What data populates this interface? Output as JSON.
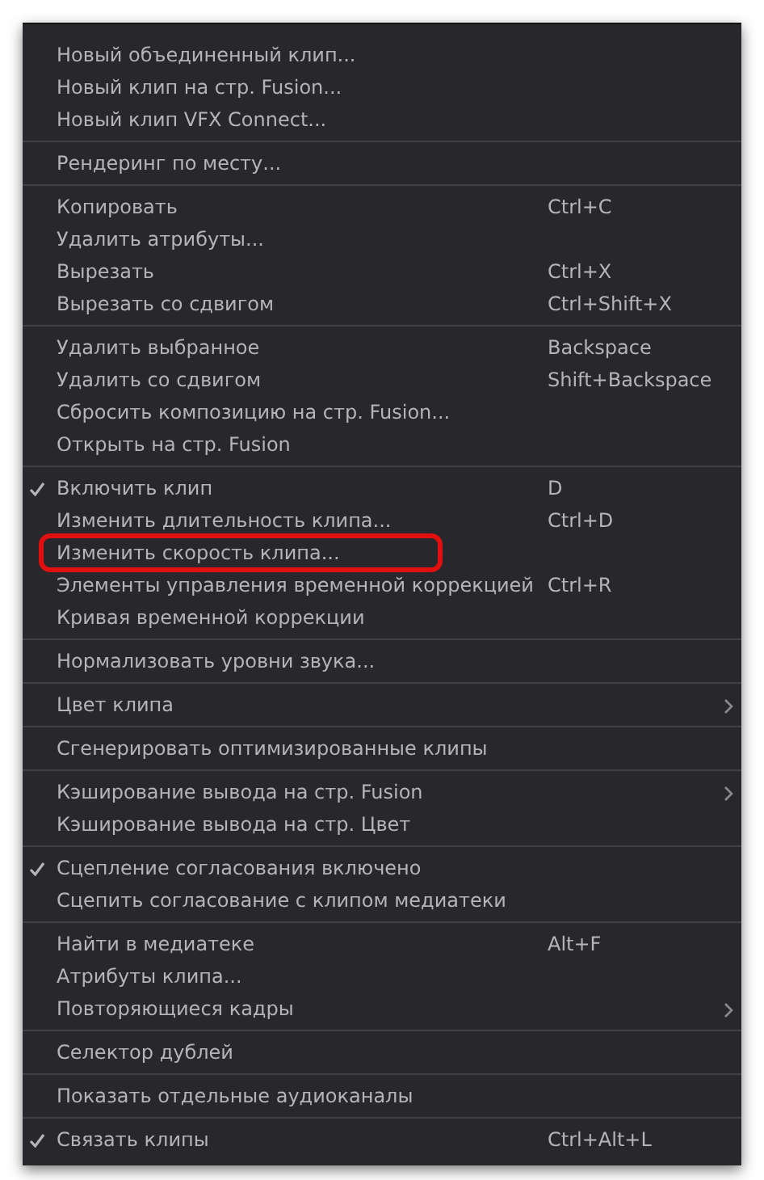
{
  "menu": {
    "groups": [
      {
        "items": [
          {
            "label": "Новый объединенный клип...",
            "kind": "command",
            "checked": false
          },
          {
            "label": "Новый клип на стр. Fusion...",
            "kind": "command",
            "checked": false
          },
          {
            "label": "Новый клип VFX Connect...",
            "kind": "command",
            "checked": false
          }
        ]
      },
      {
        "items": [
          {
            "label": "Рендеринг по месту...",
            "kind": "command",
            "checked": false
          }
        ]
      },
      {
        "items": [
          {
            "label": "Копировать",
            "shortcut": "Ctrl+C",
            "kind": "command",
            "checked": false
          },
          {
            "label": "Удалить атрибуты...",
            "kind": "command",
            "checked": false
          },
          {
            "label": "Вырезать",
            "shortcut": "Ctrl+X",
            "kind": "command",
            "checked": false
          },
          {
            "label": "Вырезать со сдвигом",
            "shortcut": "Ctrl+Shift+X",
            "kind": "command",
            "checked": false
          }
        ]
      },
      {
        "items": [
          {
            "label": "Удалить выбранное",
            "shortcut": "Backspace",
            "kind": "command",
            "checked": false
          },
          {
            "label": "Удалить со сдвигом",
            "shortcut": "Shift+Backspace",
            "kind": "command",
            "checked": false
          },
          {
            "label": "Сбросить композицию на стр. Fusion...",
            "kind": "command",
            "checked": false
          },
          {
            "label": "Открыть на стр. Fusion",
            "kind": "command",
            "checked": false
          }
        ]
      },
      {
        "items": [
          {
            "label": "Включить клип",
            "shortcut": "D",
            "kind": "command",
            "checked": true
          },
          {
            "label": "Изменить длительность клипа...",
            "shortcut": "Ctrl+D",
            "kind": "command",
            "checked": false
          },
          {
            "label": "Изменить скорость клипа...",
            "kind": "command",
            "checked": false,
            "highlighted": true
          },
          {
            "label": "Элементы управления временной коррекцией",
            "shortcut": "Ctrl+R",
            "kind": "command",
            "checked": false
          },
          {
            "label": "Кривая временной коррекции",
            "kind": "command",
            "checked": false
          }
        ]
      },
      {
        "items": [
          {
            "label": "Нормализовать уровни звука...",
            "kind": "command",
            "checked": false
          }
        ]
      },
      {
        "items": [
          {
            "label": "Цвет клипа",
            "kind": "submenu",
            "checked": false
          }
        ]
      },
      {
        "items": [
          {
            "label": "Сгенерировать оптимизированные клипы",
            "kind": "command",
            "checked": false
          }
        ]
      },
      {
        "items": [
          {
            "label": "Кэширование вывода на стр. Fusion",
            "kind": "submenu",
            "checked": false
          },
          {
            "label": "Кэширование вывода на стр. Цвет",
            "kind": "command",
            "checked": false
          }
        ]
      },
      {
        "items": [
          {
            "label": "Сцепление согласования включено",
            "kind": "command",
            "checked": true
          },
          {
            "label": "Сцепить согласование с клипом медиатеки",
            "kind": "command",
            "checked": false
          }
        ]
      },
      {
        "items": [
          {
            "label": "Найти в медиатеке",
            "shortcut": "Alt+F",
            "kind": "command",
            "checked": false
          },
          {
            "label": "Атрибуты клипа...",
            "kind": "command",
            "checked": false
          },
          {
            "label": "Повторяющиеся кадры",
            "kind": "submenu",
            "checked": false
          }
        ]
      },
      {
        "items": [
          {
            "label": "Селектор дублей",
            "kind": "command",
            "checked": false
          }
        ]
      },
      {
        "items": [
          {
            "label": "Показать отдельные аудиоканалы",
            "kind": "command",
            "checked": false
          }
        ]
      },
      {
        "items": [
          {
            "label": "Связать клипы",
            "shortcut": "Ctrl+Alt+L",
            "kind": "command",
            "checked": true
          }
        ]
      }
    ]
  }
}
